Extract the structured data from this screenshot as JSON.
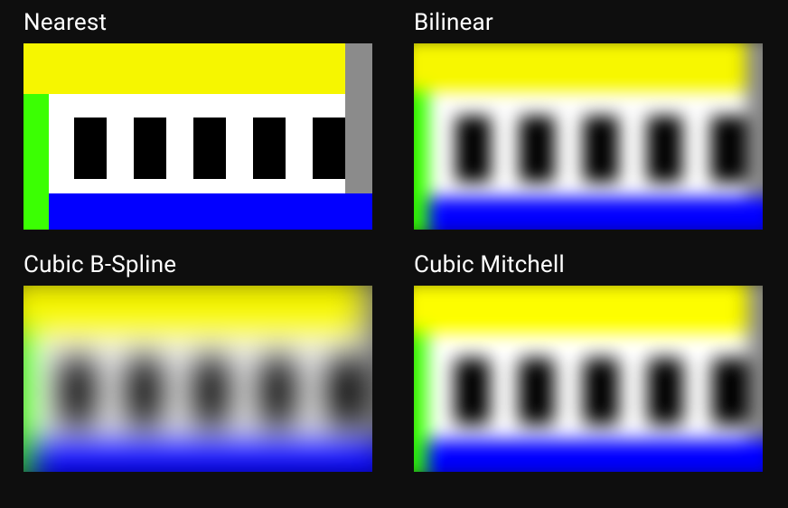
{
  "panels": [
    {
      "key": "nearest",
      "label": "Nearest",
      "filter_class": "nearest"
    },
    {
      "key": "bilinear",
      "label": "Bilinear",
      "filter_class": "bilinear"
    },
    {
      "key": "bspline",
      "label": "Cubic B-Spline",
      "filter_class": "bspline"
    },
    {
      "key": "mitchell",
      "label": "Cubic Mitchell",
      "filter_class": "mitchell"
    }
  ],
  "colors": {
    "background": "#0e0e0e",
    "yellow": "#f6f600",
    "blue": "#0200ff",
    "green": "#3bff03",
    "gray": "#8b8b8b",
    "white": "#ffffff",
    "black": "#000000"
  },
  "sample_pattern": {
    "description": "A tiny test image (roughly 12x6 pixels) upscaled with different reconstruction filters. Top band yellow, left column green, right column gray (cut off above the bottom band), bottom band blue, white center containing 5 black vertical bars."
  }
}
